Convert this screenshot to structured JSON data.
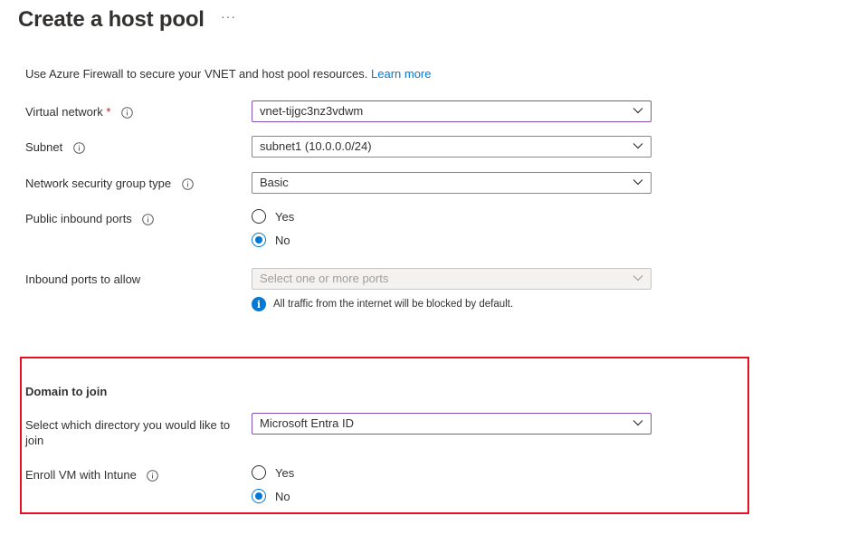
{
  "page": {
    "title": "Create a host pool",
    "more_icon": "ellipsis-icon",
    "more_label": "···"
  },
  "intro": {
    "text": "Use Azure Firewall to secure your VNET and host pool resources. ",
    "link": "Learn more"
  },
  "fields": {
    "virtual_network": {
      "label": "Virtual network",
      "required": "*",
      "value": "vnet-tijgc3nz3vdwm"
    },
    "subnet": {
      "label": "Subnet",
      "value": "subnet1 (10.0.0.0/24)"
    },
    "nsg_type": {
      "label": "Network security group type",
      "value": "Basic"
    },
    "public_inbound_ports": {
      "label": "Public inbound ports",
      "options": [
        "Yes",
        "No"
      ],
      "selected": "No"
    },
    "inbound_ports_allow": {
      "label": "Inbound ports to allow",
      "placeholder": "Select one or more ports",
      "note": "All traffic from the internet will be blocked by default."
    }
  },
  "domain": {
    "heading": "Domain to join",
    "directory": {
      "label_line1": "Select which directory you would like to",
      "label_line2": "join",
      "value": "Microsoft Entra ID"
    },
    "intune": {
      "label": "Enroll VM with Intune",
      "options": [
        "Yes",
        "No"
      ],
      "selected": "No"
    }
  },
  "colors": {
    "accent": "#0078d4",
    "focus": "#8a4fb3",
    "highlight": "#e81123",
    "required": "#a4262c"
  },
  "icons": {
    "info": "info-icon",
    "chevron": "chevron-down-icon",
    "info_filled": "info-filled-icon"
  }
}
